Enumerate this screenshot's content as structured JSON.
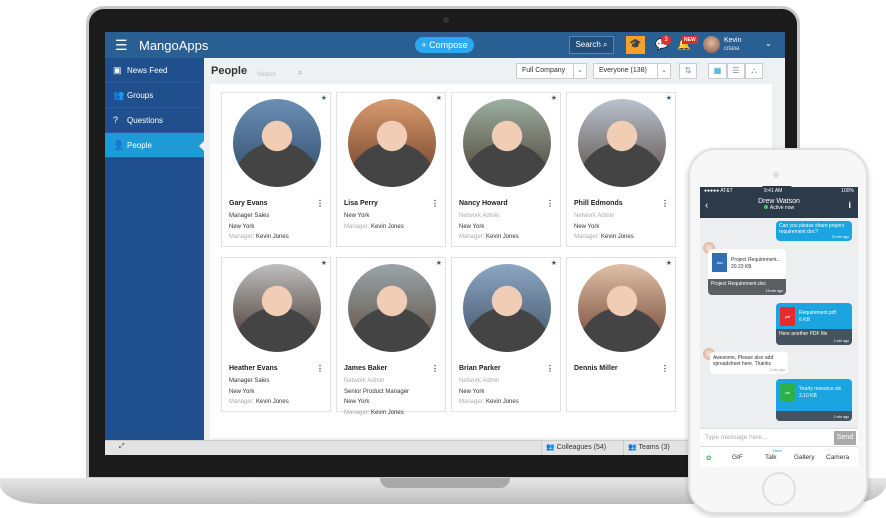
{
  "topbar": {
    "app_name": "MangoApps",
    "compose_label": "+ Compose",
    "search_label": "Search",
    "chat_badge": "3",
    "new_badge": "NEW",
    "user_name": "Kevin",
    "user_sub": "citalia"
  },
  "sidebar": {
    "items": [
      {
        "label": "News Feed",
        "icon": "inbox-icon"
      },
      {
        "label": "Groups",
        "icon": "groups-icon"
      },
      {
        "label": "Questions",
        "icon": "question-icon"
      },
      {
        "label": "People",
        "icon": "person-icon",
        "active": true
      }
    ]
  },
  "main": {
    "title": "People",
    "search_placeholder": "Search",
    "filter_scope": "Full Company",
    "filter_group": "Everyone (138)"
  },
  "people": [
    {
      "name": "Gary Evans",
      "lines": [
        [
          "",
          "Manager Sales"
        ],
        [
          "",
          "New York"
        ],
        [
          "Manager: ",
          "Kevin Jones"
        ]
      ]
    },
    {
      "name": "Lisa Perry",
      "lines": [
        [
          "",
          "New York"
        ],
        [
          "Manager: ",
          "Kevin Jones"
        ]
      ]
    },
    {
      "name": "Nancy Howard",
      "lines": [
        [
          "Network Admin",
          ""
        ],
        [
          "",
          "New York"
        ],
        [
          "Manager: ",
          "Kevin Jones"
        ]
      ]
    },
    {
      "name": "Phill Edmonds",
      "lines": [
        [
          "Network Admin",
          ""
        ],
        [
          "",
          "New York"
        ],
        [
          "Manager: ",
          "Kevin Jones"
        ]
      ]
    },
    {
      "name": "Heather Evans",
      "lines": [
        [
          "",
          "Manager Sales"
        ],
        [
          "",
          "New York"
        ],
        [
          "Manager: ",
          "Kevin Jones"
        ]
      ]
    },
    {
      "name": "James Baker",
      "lines": [
        [
          "Network Admin",
          ""
        ],
        [
          "",
          "Senior Product Manager"
        ],
        [
          "",
          "New York"
        ],
        [
          "Manager: ",
          "Kevin Jones"
        ]
      ]
    },
    {
      "name": "Brian Parker",
      "lines": [
        [
          "Network Admin",
          ""
        ],
        [
          "",
          "New York"
        ],
        [
          "Manager: ",
          "Kevin Jones"
        ]
      ]
    },
    {
      "name": "Dennis Miller",
      "lines": []
    }
  ],
  "bottombar": {
    "colleagues": "Colleagues (54)",
    "teams": "Teams (3)"
  },
  "phone": {
    "carrier": "●●●●● AT&T",
    "time": "9:41 AM",
    "battery": "100%",
    "contact": "Drew Watson",
    "presence": "Active now",
    "messages": [
      {
        "text": "Can you please share project requirement doc?",
        "time": "20 min ago"
      },
      {
        "file": "Project Requirement...",
        "size": "20.23 KB",
        "ext": ".doc",
        "caption": "Project Requirement.doc",
        "time": "15 min ago"
      },
      {
        "file": "Requirement.pdf",
        "size": "6 KB",
        "ext": "pdf",
        "caption": "Here another PDF file",
        "time": "1 min ago"
      },
      {
        "text": "Awesome, Please also add spreadsheet here. Thanks",
        "time": "2 min ago"
      },
      {
        "file": "Yearly resource.xls",
        "size": "3.10 KB",
        "ext": "xls",
        "time": "1 min ago"
      }
    ],
    "input_placeholder": "Type message here...",
    "send_label": "Send",
    "tabs": [
      "GIF",
      "Talk",
      "Gallery",
      "Camera"
    ],
    "talk_badge": "New!"
  },
  "colors": {
    "topbar": "#2a5f94",
    "sidebar": "#1f4f8d",
    "active": "#1e9ad6",
    "compose": "#2fa7f0"
  }
}
